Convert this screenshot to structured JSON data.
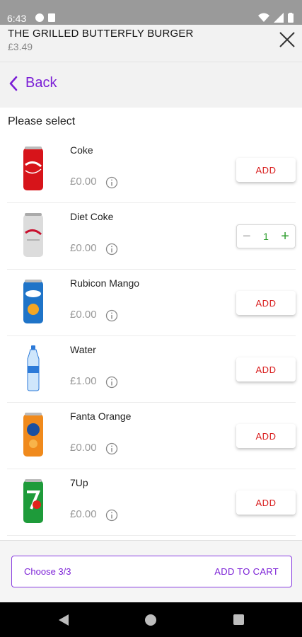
{
  "status_bar": {
    "time": "6:43"
  },
  "header": {
    "title": "THE GRILLED BUTTERFLY BURGER",
    "price": "£3.49"
  },
  "back": {
    "label": "Back"
  },
  "prompt": "Please select",
  "products": [
    {
      "name": "Coke",
      "price": "£0.00",
      "action": "ADD",
      "image_icon": "coke-can-icon",
      "colors": [
        "#d7141a",
        "#ffffff"
      ]
    },
    {
      "name": "Diet Coke",
      "price": "£0.00",
      "quantity": "1",
      "image_icon": "diet-coke-can-icon",
      "colors": [
        "#dcdcdc",
        "#c8102e"
      ]
    },
    {
      "name": "Rubicon Mango",
      "price": "£0.00",
      "action": "ADD",
      "image_icon": "rubicon-mango-can-icon",
      "colors": [
        "#1f74c8",
        "#f5a623"
      ]
    },
    {
      "name": "Water",
      "price": "£1.00",
      "action": "ADD",
      "image_icon": "water-bottle-icon",
      "colors": [
        "#cfe6fb",
        "#2c7ad8"
      ]
    },
    {
      "name": "Fanta Orange",
      "price": "£0.00",
      "action": "ADD",
      "image_icon": "fanta-orange-can-icon",
      "colors": [
        "#f08a1c",
        "#1a4fa0"
      ]
    },
    {
      "name": "7Up",
      "price": "£0.00",
      "action": "ADD",
      "image_icon": "7up-can-icon",
      "colors": [
        "#1e9b3a",
        "#e2231a"
      ]
    }
  ],
  "footer": {
    "choose": "Choose 3/3",
    "add_to_cart": "ADD TO CART"
  },
  "colors": {
    "accent": "#7b1fd6",
    "add": "#d81b1b",
    "stepper": "#2e9e2e"
  }
}
